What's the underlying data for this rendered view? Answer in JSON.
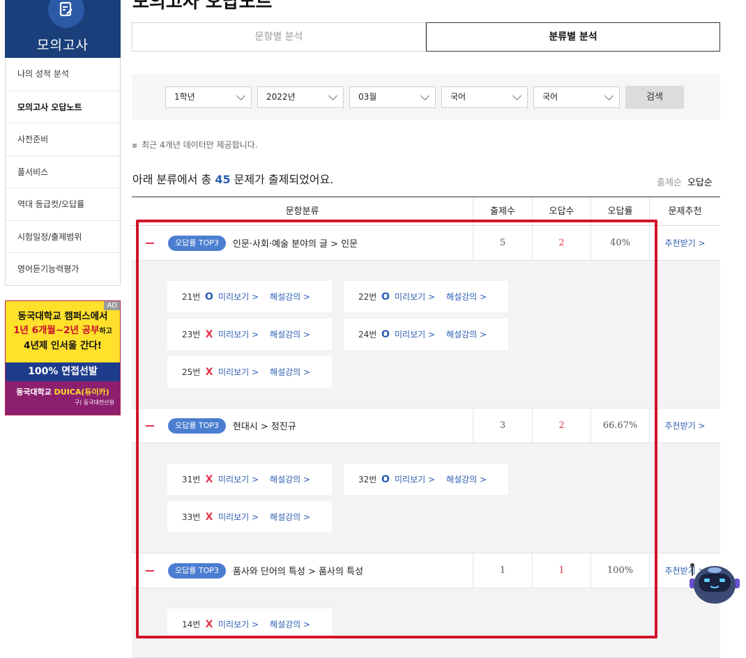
{
  "page": {
    "title": "모의고사 오답노트"
  },
  "sidebar": {
    "title": "모의고사",
    "items": [
      {
        "label": "나의 성적 분석",
        "active": false
      },
      {
        "label": "모의고사 오답노트",
        "active": true
      },
      {
        "label": "사전준비",
        "active": false
      },
      {
        "label": "풀서비스",
        "active": false
      },
      {
        "label": "역대 등급컷/오답률",
        "active": false
      },
      {
        "label": "시험일정/출제범위",
        "active": false
      },
      {
        "label": "영어듣기능력평가",
        "active": false
      }
    ]
  },
  "ad": {
    "tag": "AD",
    "line1": "동국대학교 캠퍼스에서",
    "line2_red": "1년 6개월~2년 공부",
    "line2_small": "하고",
    "line3": "4년제 인서울 간다!",
    "mid": "100% 면접선발",
    "bot_a": "동국대학교 ",
    "bot_b": "DUICA(듀이카)",
    "bot_c": "구) 동국대전산원"
  },
  "tabs": [
    {
      "label": "문항별 분석",
      "active": false
    },
    {
      "label": "분류별 분석",
      "active": true
    }
  ],
  "filters": {
    "grade": "1학년",
    "year": "2022년",
    "month": "03월",
    "subject": "국어",
    "sub_subject": "국어",
    "search_label": "검색"
  },
  "notice": "최근 4개년 데이터만 제공합니다.",
  "summary": {
    "prefix": "아래 분류에서 총 ",
    "count": "45",
    "suffix": " 문제가 출제되었어요."
  },
  "sort": {
    "by_count": "출제순",
    "by_wrong": "오답순"
  },
  "table": {
    "headers": [
      "문항분류",
      "출제수",
      "오답수",
      "오답률",
      "문제추천"
    ],
    "rows": [
      {
        "badge": "오답률 TOP3",
        "category": "인문·사회·예술 분야의 글 > 인문",
        "count": "5",
        "wrong": "2",
        "rate": "40%",
        "recommend": "추천받기 >",
        "questions": [
          {
            "no": "21번",
            "mark": "O"
          },
          {
            "no": "22번",
            "mark": "O"
          },
          {
            "no": "23번",
            "mark": "X"
          },
          {
            "no": "24번",
            "mark": "O"
          },
          {
            "no": "25번",
            "mark": "X"
          }
        ]
      },
      {
        "badge": "오답률 TOP3",
        "category": "현대시 > 정진규",
        "count": "3",
        "wrong": "2",
        "rate": "66.67%",
        "recommend": "추천받기 >",
        "questions": [
          {
            "no": "31번",
            "mark": "X"
          },
          {
            "no": "32번",
            "mark": "O"
          },
          {
            "no": "33번",
            "mark": "X"
          }
        ]
      },
      {
        "badge": "오답률 TOP3",
        "category": "품사와 단어의 특성 > 품사의 특성",
        "count": "1",
        "wrong": "1",
        "rate": "100%",
        "recommend": "추천받기 >",
        "questions": [
          {
            "no": "14번",
            "mark": "X"
          }
        ]
      }
    ],
    "preview_label": "미리보기 >",
    "lecture_label": "해설강의 >"
  }
}
